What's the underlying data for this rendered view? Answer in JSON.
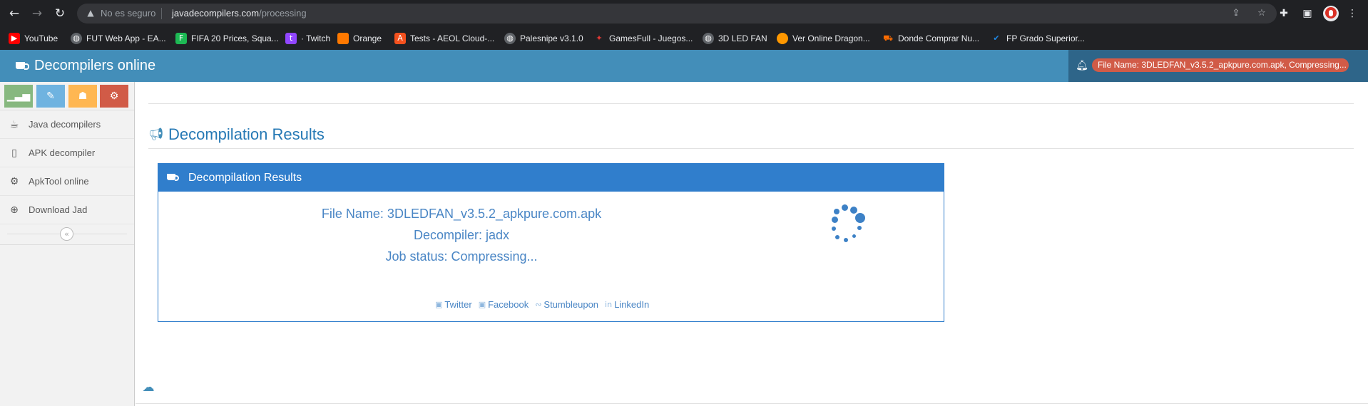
{
  "browser": {
    "insecure_label": "No es seguro",
    "url_host": "javadecompilers.com",
    "url_path": "/processing",
    "bookmarks": [
      {
        "label": "YouTube",
        "icon": "youtube-icon",
        "color": "#ff0000"
      },
      {
        "label": "FUT Web App - EA...",
        "icon": "globe-icon",
        "color": "#5f6368"
      },
      {
        "label": "FIFA 20 Prices, Squa...",
        "icon": "futbin-icon",
        "color": "#1db954"
      },
      {
        "label": "· Twitch",
        "icon": "twitch-icon",
        "color": "#9146ff"
      },
      {
        "label": "Orange",
        "icon": "orange-icon",
        "color": "#ff7900"
      },
      {
        "label": "Tests - AEOL Cloud-...",
        "icon": "aeol-icon",
        "color": "#f4511e"
      },
      {
        "label": "Palesnipe v3.1.0",
        "icon": "globe-icon",
        "color": "#5f6368"
      },
      {
        "label": "GamesFull - Juegos...",
        "icon": "gamepad-icon",
        "color": "#e53935"
      },
      {
        "label": "3D LED FAN",
        "icon": "globe-icon",
        "color": "#5f6368"
      },
      {
        "label": "Ver Online Dragon...",
        "icon": "dragonball-icon",
        "color": "#ff9800"
      },
      {
        "label": "Donde Comprar Nu...",
        "icon": "cart-icon",
        "color": "#ff6d00"
      },
      {
        "label": "FP Grado Superior...",
        "icon": "checkmark-icon",
        "color": "#1e88e5"
      }
    ]
  },
  "app": {
    "brand": "Decompilers online",
    "notification": "File Name: 3DLEDFAN_v3.5.2_apkpure.com.apk, Compressing...",
    "accent": "#438eb9"
  },
  "sidebar": {
    "items": [
      {
        "label": "Java decompilers",
        "icon": "coffee-icon"
      },
      {
        "label": "APK decompiler",
        "icon": "mobile-icon"
      },
      {
        "label": "ApkTool online",
        "icon": "gear-icon"
      },
      {
        "label": "Download Jad",
        "icon": "download-icon"
      }
    ]
  },
  "main": {
    "page_title": "Decompilation Results",
    "widget_title": "Decompilation Results",
    "file_name": "File Name: 3DLEDFAN_v3.5.2_apkpure.com.apk",
    "decompiler": "Decompiler: jadx",
    "job_status": "Job status: Compressing...",
    "share": {
      "twitter": "Twitter",
      "facebook": "Facebook",
      "stumbleupon": "Stumbleupon",
      "linkedin": "LinkedIn"
    }
  }
}
